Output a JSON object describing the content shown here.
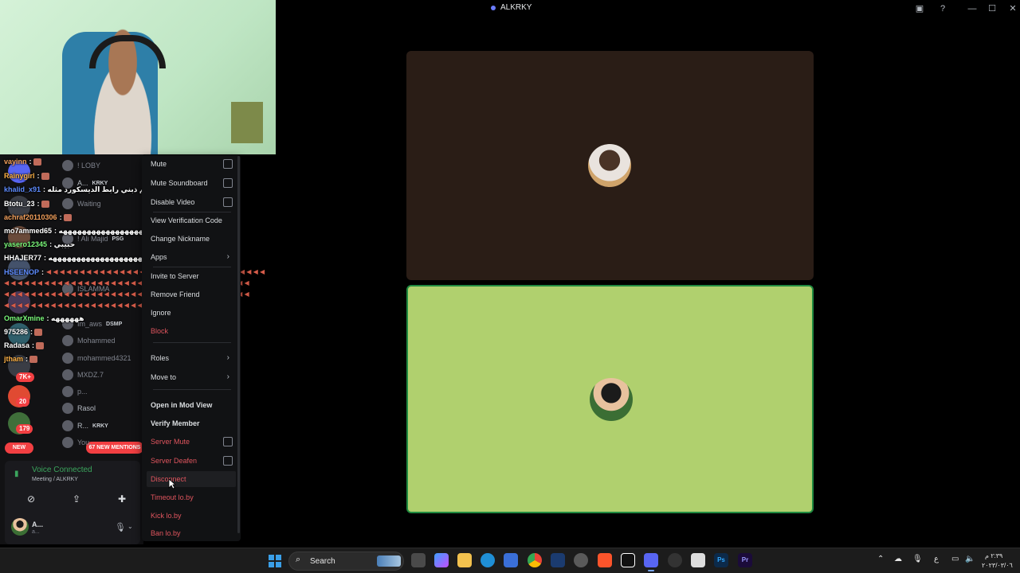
{
  "window": {
    "title": "ALKRKY",
    "controls": [
      "minimize-icon",
      "maximize-icon",
      "close-icon"
    ],
    "toolbar_icons": [
      "screen-share-icon",
      "help-icon"
    ]
  },
  "stage": {
    "tiles": [
      {
        "name": "participant-1",
        "bg": "#2a1d16",
        "speaking": false
      },
      {
        "name": "participant-2",
        "bg": "#b0d06e",
        "speaking": true,
        "speaking_color": "#1f8a40"
      }
    ]
  },
  "sidebar": {
    "servers": [
      {
        "badge": "7K+"
      },
      {
        "badge": "20"
      },
      {
        "badge": "179"
      }
    ],
    "new_label": "NEW",
    "mentions_label": "67 NEW MENTIONS",
    "members": [
      {
        "name": "! LOBY",
        "tag": ""
      },
      {
        "name": "A...",
        "tag": "KRKY"
      },
      {
        "name": "Waiting",
        "tag": ""
      },
      {
        "name": "! Ali Majid",
        "tag": "PSG"
      },
      {
        "name": "ISLAMMA",
        "tag": ""
      },
      {
        "name": "Im_aws",
        "tag": "DSMP"
      },
      {
        "name": "Mohammed",
        "tag": ""
      },
      {
        "name": "mohammed4321",
        "tag": ""
      },
      {
        "name": "MXDZ.7",
        "tag": ""
      },
      {
        "name": "p...",
        "tag": ""
      },
      {
        "name": "Rasol",
        "tag": ""
      },
      {
        "name": "R...",
        "tag": "KRKY"
      },
      {
        "name": "You...",
        "tag": ""
      }
    ]
  },
  "chat": [
    {
      "user": "vayinn",
      "color": "#f4a15d",
      "text": ":"
    },
    {
      "user": "Rainygirl",
      "color": "#ffb347",
      "text": ":"
    },
    {
      "user": "khalid_x91",
      "color": "#5e8cff",
      "text": ": ريم ذبني رابط الديسكورد مثله"
    },
    {
      "user": "Btotu_23",
      "color": "#ffffff",
      "text": ":"
    },
    {
      "user": "achraf20110306",
      "color": "#f4a15d",
      "text": ":"
    },
    {
      "user": "mo7ammed65",
      "color": "#ffffff",
      "text": ": يكله الحمدلله هههههههههههههههههههه"
    },
    {
      "user": "yasero12345",
      "color": "#7cfc7c",
      "text": ": حبيبي"
    },
    {
      "user": "HHAJER77",
      "color": "#ffffff",
      "text": ": ههههههههههههههههههههه"
    },
    {
      "user": "HSEENOP",
      "color": "#5e8cff",
      "text": ":"
    },
    {
      "user": "OmarXmine",
      "color": "#7cfc7c",
      "text": ": ههههههه"
    },
    {
      "user": "975286",
      "color": "#ffffff",
      "text": ":"
    },
    {
      "user": "Radasa",
      "color": "#ffffff",
      "text": ":"
    },
    {
      "user": "jtham",
      "color": "#ffb347",
      "text": ":"
    }
  ],
  "voice_panel": {
    "status": "Voice Connected",
    "channel": "Meeting / ALKRKY",
    "buttons": [
      "video-off-icon",
      "screen-share-icon",
      "activities-icon"
    ],
    "user_name": "A...",
    "user_sub": "a..."
  },
  "context_menu": {
    "items": [
      {
        "label": "Mute",
        "style": "normal",
        "checkbox": true
      },
      {
        "label": "Mute Soundboard",
        "style": "normal",
        "checkbox": true
      },
      {
        "label": "Disable Video",
        "style": "normal",
        "checkbox": true
      },
      {
        "label": "View Verification Code",
        "style": "normal"
      },
      {
        "label": "Change Nickname",
        "style": "normal"
      },
      {
        "label": "Apps",
        "style": "normal",
        "submenu": true
      },
      {
        "label": "Invite to Server",
        "style": "normal"
      },
      {
        "label": "Remove Friend",
        "style": "normal"
      },
      {
        "label": "Ignore",
        "style": "normal"
      },
      {
        "label": "Block",
        "style": "red"
      },
      {
        "label": "Roles",
        "style": "normal",
        "submenu": true
      },
      {
        "label": "Move to",
        "style": "normal",
        "submenu": true
      },
      {
        "label": "Open in Mod View",
        "style": "bold"
      },
      {
        "label": "Verify Member",
        "style": "bold"
      },
      {
        "label": "Server Mute",
        "style": "red",
        "checkbox": true
      },
      {
        "label": "Server Deafen",
        "style": "red",
        "checkbox": true
      },
      {
        "label": "Disconnect",
        "style": "red",
        "hover": true
      },
      {
        "label": "Timeout lo.by",
        "style": "red"
      },
      {
        "label": "Kick lo.by",
        "style": "red"
      },
      {
        "label": "Ban lo.by",
        "style": "red"
      }
    ]
  },
  "taskbar": {
    "search_label": "Search",
    "clock_time": "٢:٣٩ م",
    "clock_date": "٢٠٢٣/٠٣/٠٦",
    "lang": "ع",
    "apps": [
      "task-view-icon",
      "copilot-icon",
      "file-explorer-icon",
      "edge-icon",
      "store-icon",
      "chrome-icon",
      "steam-icon",
      "settings-icon",
      "brave-icon",
      "capcut-icon",
      "discord-icon",
      "obs-icon",
      "notepad-icon",
      "photoshop-icon",
      "premiere-icon"
    ]
  }
}
